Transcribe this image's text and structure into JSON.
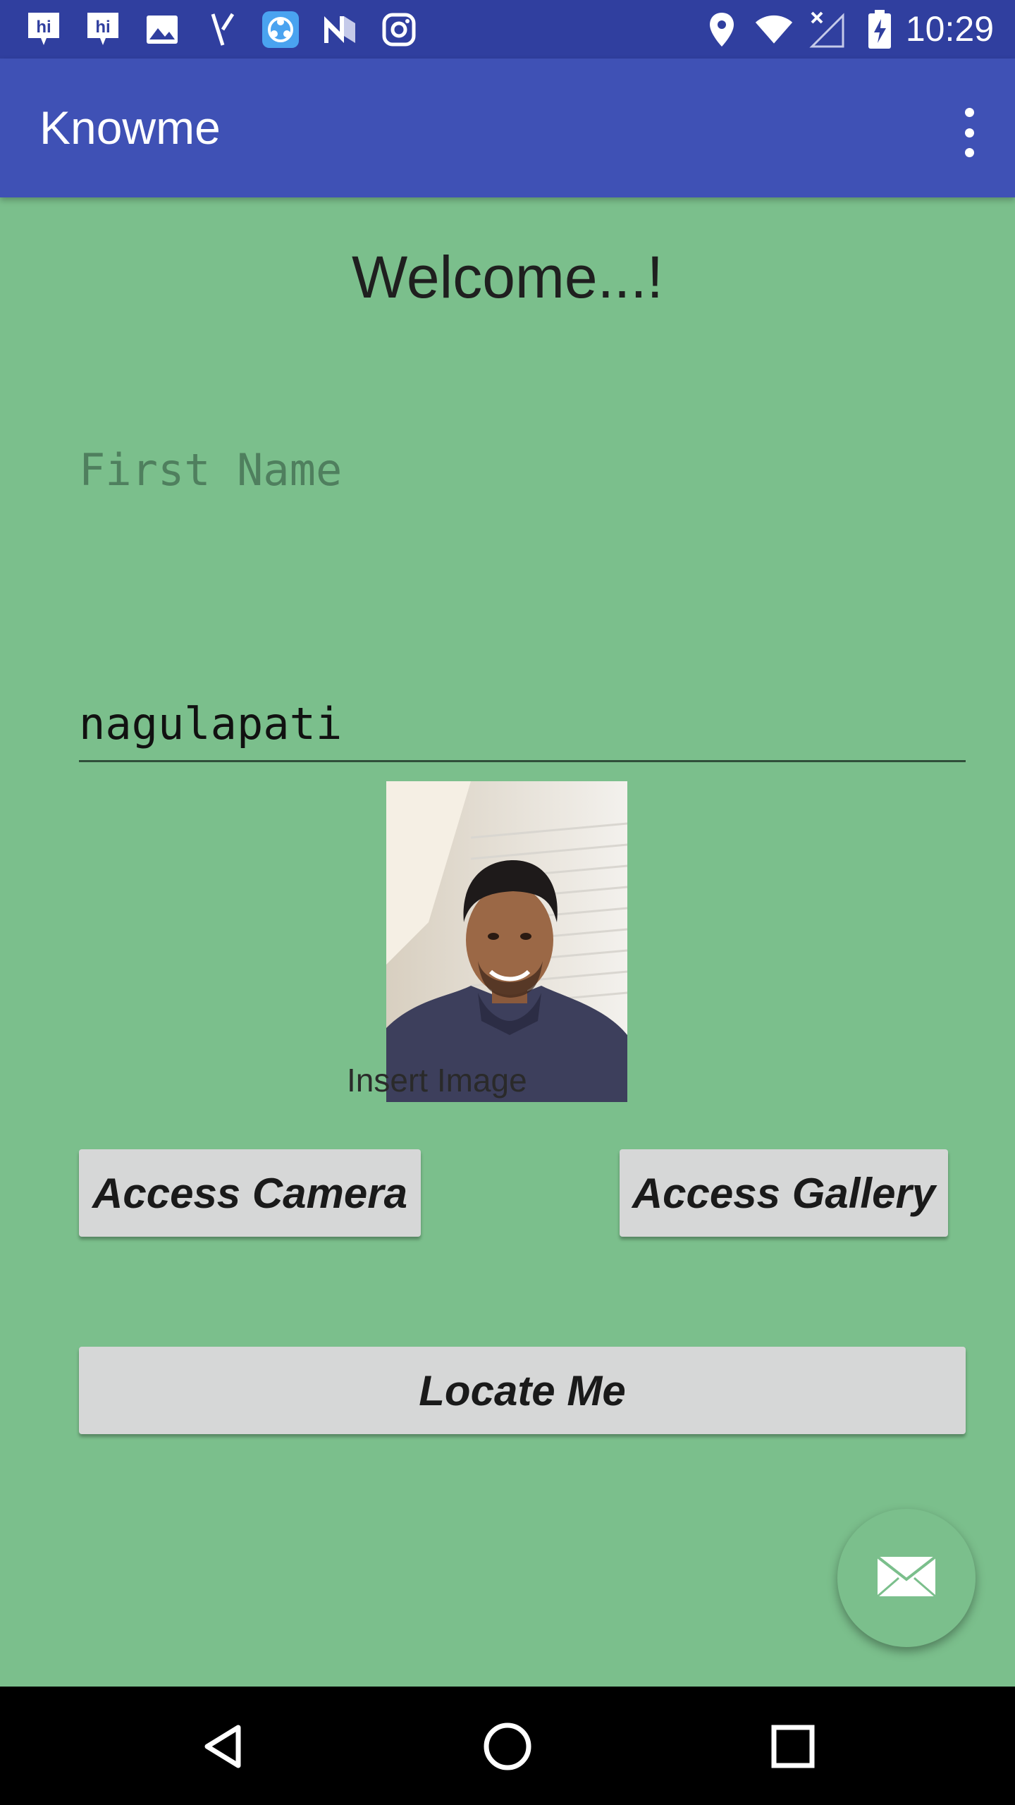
{
  "status_bar": {
    "time": "10:29",
    "left_icons": [
      "hike-icon",
      "hike-icon",
      "gallery-icon",
      "compass-icon",
      "shareit-icon",
      "n-icon",
      "instagram-icon"
    ],
    "right_icons": [
      "location-icon",
      "wifi-icon",
      "no-signal-icon",
      "battery-charging-icon"
    ],
    "colors": {
      "background": "#303f9f"
    }
  },
  "app_bar": {
    "title": "Knowme",
    "menu_icon": "overflow-menu-icon",
    "colors": {
      "background": "#3f51b5"
    }
  },
  "main": {
    "welcome_text": "Welcome...!",
    "first_name": {
      "placeholder": "First Name",
      "value": ""
    },
    "last_name": {
      "value": "nagulapati"
    },
    "image_label": "Insert Image",
    "buttons": {
      "camera": "Access Camera",
      "gallery": "Access Gallery",
      "locate": "Locate Me"
    },
    "fab_icon": "email-icon",
    "colors": {
      "background": "#7bbf8c",
      "button": "#d6d7d7"
    }
  },
  "nav_bar": {
    "icons": [
      "back-icon",
      "home-icon",
      "recents-icon"
    ]
  }
}
